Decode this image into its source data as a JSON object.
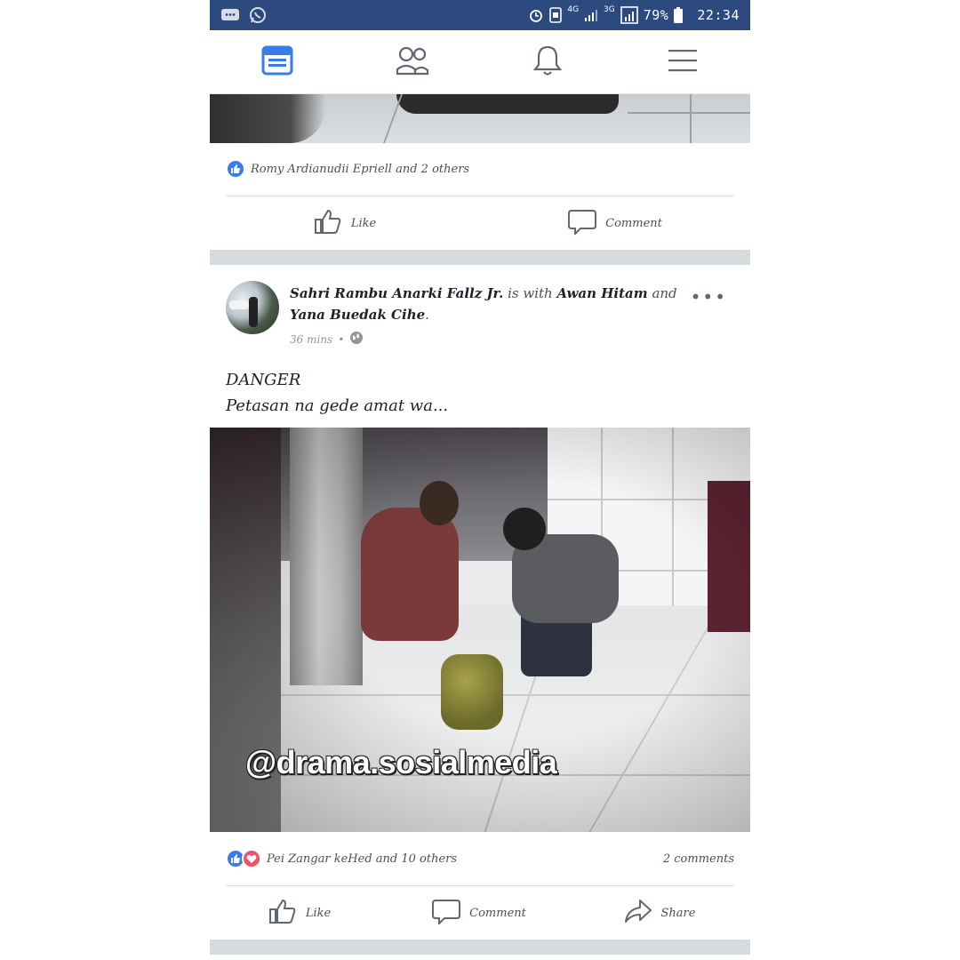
{
  "status_bar": {
    "battery": "79%",
    "time": "22:34",
    "net_1": "4G",
    "net_2": "3G"
  },
  "nav": {
    "tabs": [
      {
        "icon": "news-feed-icon",
        "active": true
      },
      {
        "icon": "friends-icon",
        "active": false
      },
      {
        "icon": "notifications-icon",
        "active": false
      },
      {
        "icon": "menu-icon",
        "active": false
      }
    ],
    "accent": "#3b7be8"
  },
  "previous_post": {
    "reactions_text": "Romy Ardianudii Epriell and 2 others",
    "like_label": "Like",
    "comment_label": "Comment"
  },
  "post": {
    "author": "Sahri Rambu Anarki Fallz Jr.",
    "with_text": "is with",
    "tagged_1": "Awan Hitam",
    "and_text": "and",
    "tagged_2": "Yana Buedak Cihe",
    "time": "36 mins",
    "text_line_1": "DANGER",
    "text_line_2": "Petasan na gede amat wa...",
    "watermark": "@drama.sosialmedia",
    "reactions_text": "Pei Zangar keHed and 10 others",
    "comments_count": "2 comments",
    "like_label": "Like",
    "comment_label": "Comment",
    "share_label": "Share"
  },
  "colors": {
    "status_bar": "#2c4a7e",
    "like": "#3b7be8",
    "love": "#f25268",
    "separator": "#d6dbde"
  }
}
